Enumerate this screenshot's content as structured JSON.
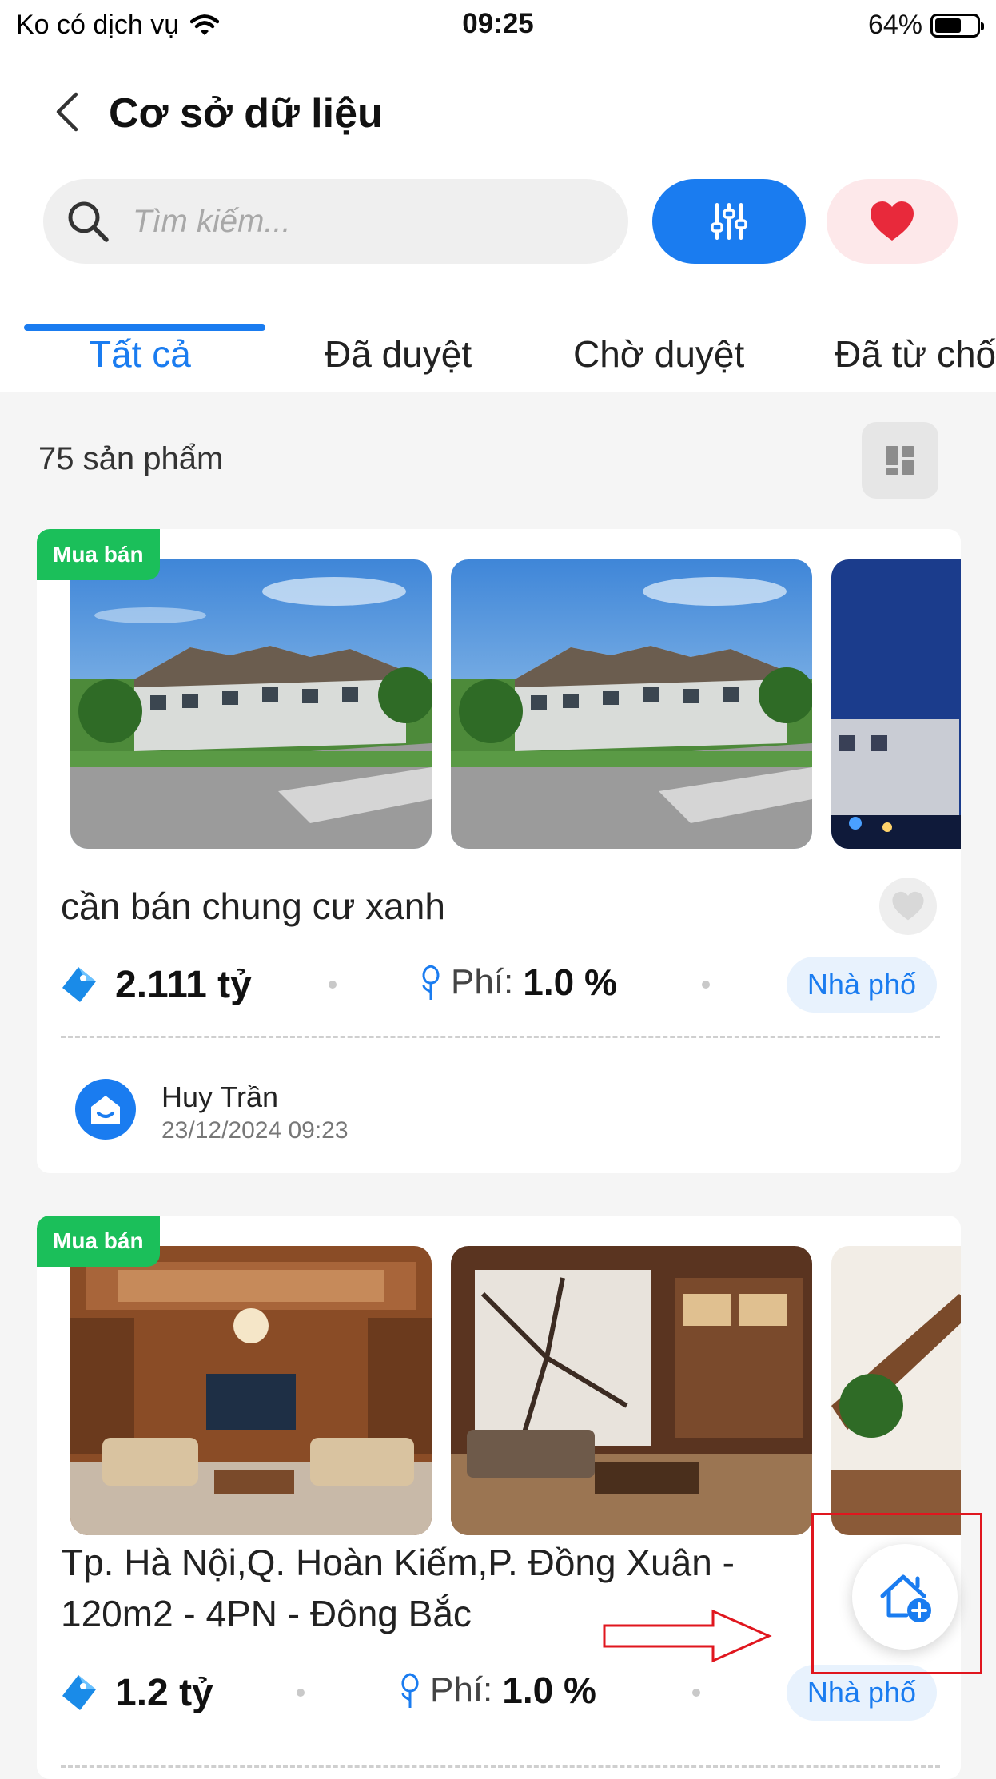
{
  "status_bar": {
    "carrier": "Ko có dịch vụ",
    "time": "09:25",
    "battery": "64%",
    "battery_level": 0.64
  },
  "header": {
    "title": "Cơ sở dữ liệu"
  },
  "search": {
    "placeholder": "Tìm kiếm..."
  },
  "tabs": [
    {
      "label": "Tất cả",
      "active": true
    },
    {
      "label": "Đã duyệt",
      "active": false
    },
    {
      "label": "Chờ duyệt",
      "active": false
    },
    {
      "label": "Đã từ chối",
      "active": false
    }
  ],
  "listing": {
    "count_label": "75 sản phẩm"
  },
  "colors": {
    "accent": "#1a7cf0",
    "tag_green": "#1bbf5a",
    "fav_bg": "#fde8ea",
    "heart": "#e8293b"
  },
  "cards": [
    {
      "tag": "Mua bán",
      "title": "cần bán chung cư xanh",
      "price": "2.111 tỷ",
      "fee_label": "Phí:",
      "fee_value": "1.0 %",
      "type": "Nhà phố",
      "owner_name": "Huy Trần",
      "owner_date": "23/12/2024 09:23",
      "photos": [
        "villa-exterior",
        "villa-exterior",
        "building-night"
      ]
    },
    {
      "tag": "Mua bán",
      "title": "Tp. Hà Nội,Q. Hoàn Kiếm,P. Đồng Xuân - 120m2 - 4PN - Đông Bắc",
      "price": "1.2 tỷ",
      "fee_label": "Phí:",
      "fee_value": "1.0 %",
      "type": "Nhà phố",
      "photos": [
        "wood-living-room",
        "marble-living-room",
        "staircase-interior"
      ]
    }
  ],
  "icons": {
    "back": "chevron-left-icon",
    "search": "search-icon",
    "filter": "sliders-icon",
    "favorite": "heart-icon",
    "layout": "grid-icon",
    "price": "price-tag-icon",
    "fee": "flower-icon",
    "add_property": "home-plus-icon"
  }
}
